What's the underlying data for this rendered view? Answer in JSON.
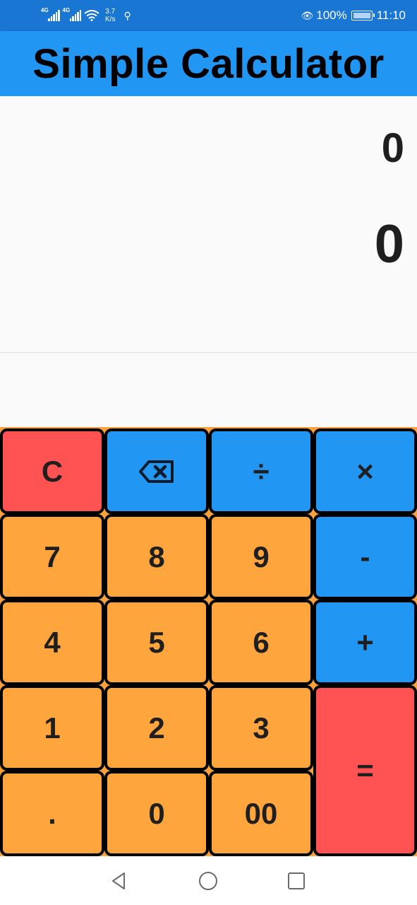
{
  "status_bar": {
    "network_1": "4G",
    "network_2": "4G",
    "speed_value": "3.7",
    "speed_unit": "K/s",
    "battery": "100%",
    "time": "11:10"
  },
  "app_bar": {
    "title": "Simple Calculator"
  },
  "display": {
    "equation": "0",
    "result": "0"
  },
  "keypad": {
    "clear": "C",
    "divide": "÷",
    "multiply": "×",
    "subtract": "-",
    "add": "+",
    "equals": "=",
    "seven": "7",
    "eight": "8",
    "nine": "9",
    "four": "4",
    "five": "5",
    "six": "6",
    "one": "1",
    "two": "2",
    "three": "3",
    "decimal": ".",
    "zero": "0",
    "double_zero": "00",
    "backspace_icon": "backspace-icon"
  },
  "colors": {
    "status_bar": "#1976d2",
    "app_bar": "#2196f3",
    "number_key": "#ffa53d",
    "operator_key": "#2196f3",
    "action_key": "#ff5252"
  }
}
